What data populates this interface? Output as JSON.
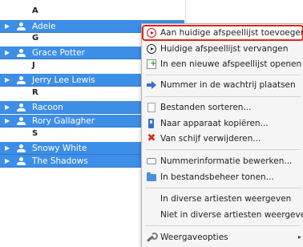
{
  "artist_list": {
    "rows": [
      {
        "type": "header",
        "letter": "A"
      },
      {
        "type": "artist",
        "name": "Adele"
      },
      {
        "type": "header",
        "letter": "G"
      },
      {
        "type": "artist",
        "name": "Grace Potter"
      },
      {
        "type": "header",
        "letter": "J"
      },
      {
        "type": "artist",
        "name": "Jerry Lee Lewis"
      },
      {
        "type": "header",
        "letter": "R"
      },
      {
        "type": "artist",
        "name": "Racoon"
      },
      {
        "type": "artist",
        "name": "Rory Gallagher"
      },
      {
        "type": "header",
        "letter": "S"
      },
      {
        "type": "artist",
        "name": "Snowy White"
      },
      {
        "type": "artist",
        "name": "The Shadows"
      }
    ]
  },
  "context_menu": {
    "items": [
      {
        "label": "Aan huidige afspeellijst toevoegen",
        "icon": "play-circle-icon",
        "highlighted": true
      },
      {
        "label": "Huidige afspeellijst vervangen",
        "icon": "play-circle-icon"
      },
      {
        "label": "In een nieuwe afspeellijst openen",
        "icon": "new-playlist-icon"
      },
      {
        "label": "Nummer in de wachtrij plaatsen",
        "icon": "queue-arrow-icon"
      },
      {
        "label": "Bestanden sorteren...",
        "icon": "document-icon"
      },
      {
        "label": "Naar apparaat kopiëren...",
        "icon": "device-icon"
      },
      {
        "label": "Van schijf verwijderen...",
        "icon": "delete-cross-icon"
      },
      {
        "label": "Nummerinformatie bewerken...",
        "icon": "tag-icon"
      },
      {
        "label": "In bestandsbeheer tonen...",
        "icon": "folder-icon"
      },
      {
        "label": "In diverse artiesten weergeven",
        "icon": ""
      },
      {
        "label": "Niet in diverse artiesten weergeven",
        "icon": ""
      },
      {
        "label": "Weergaveopties",
        "icon": "wrench-icon",
        "submenu": true
      }
    ]
  },
  "colors": {
    "selection": "#3d8ee6",
    "highlight_border": "#e2231a",
    "menu_background": "#f5f5f5"
  }
}
